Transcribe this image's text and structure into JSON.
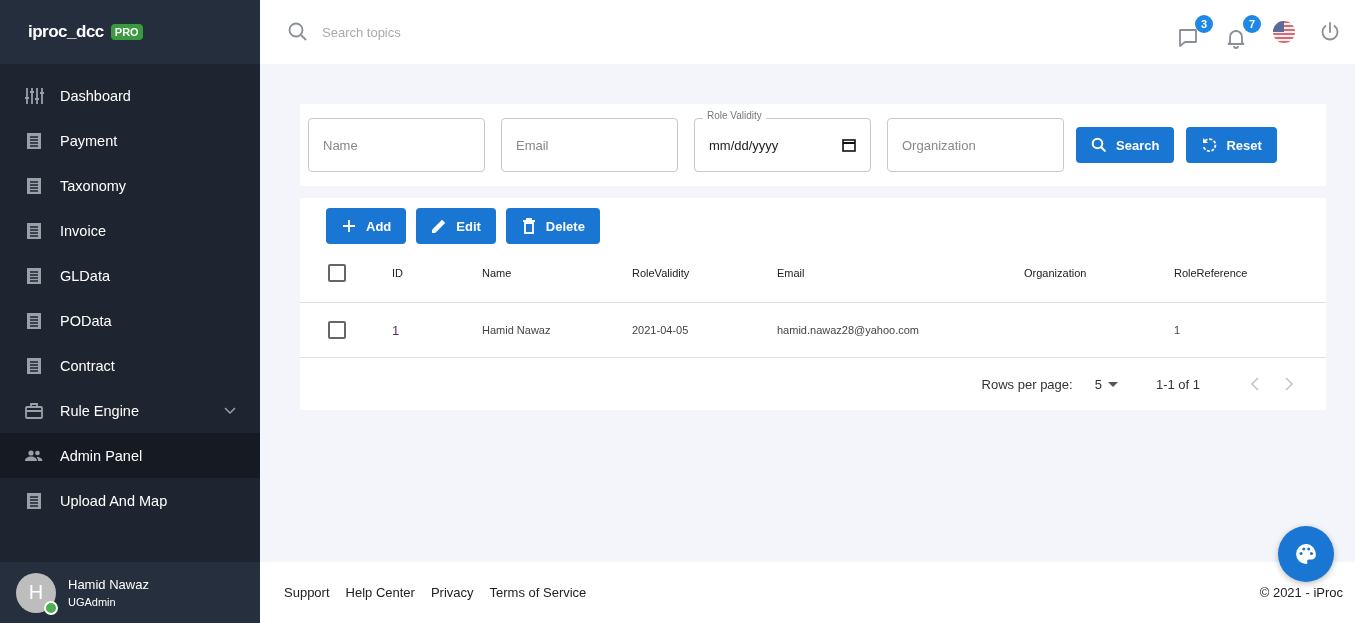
{
  "brand": {
    "name": "iproc_dcc",
    "badge": "PRO"
  },
  "sidebar": {
    "items": [
      {
        "label": "Dashboard",
        "kind": "link",
        "selected": false
      },
      {
        "label": "Payment",
        "kind": "link",
        "selected": false
      },
      {
        "label": "Taxonomy",
        "kind": "link",
        "selected": false
      },
      {
        "label": "Invoice",
        "kind": "link",
        "selected": false
      },
      {
        "label": "GLData",
        "kind": "link",
        "selected": false
      },
      {
        "label": "POData",
        "kind": "link",
        "selected": false
      },
      {
        "label": "Contract",
        "kind": "link",
        "selected": false
      },
      {
        "label": "Rule Engine",
        "kind": "group",
        "expanded": false,
        "selected": false
      },
      {
        "label": "Admin Panel",
        "kind": "link",
        "selected": true
      },
      {
        "label": "Upload And Map",
        "kind": "link",
        "selected": false
      }
    ],
    "user": {
      "initial": "H",
      "name": "Hamid Nawaz",
      "role": "UGAdmin",
      "online": true
    }
  },
  "header": {
    "search": {
      "placeholder": "Search topics"
    },
    "messages_count": "3",
    "notifications_count": "7"
  },
  "filters": {
    "name": {
      "placeholder": "Name"
    },
    "email": {
      "placeholder": "Email"
    },
    "role_validity": {
      "label": "Role Validity",
      "placeholder": "mm/dd/yyyy"
    },
    "organization": {
      "placeholder": "Organization"
    },
    "buttons": [
      "Search",
      "Reset"
    ]
  },
  "toolbar": [
    "Add",
    "Edit",
    "Delete"
  ],
  "table": {
    "header_checked": false,
    "columns": [
      "ID",
      "Name",
      "RoleValidity",
      "Email",
      "Organization",
      "RoleReference"
    ],
    "rows": [
      {
        "checked": false,
        "cells": [
          "1",
          "Hamid Nawaz",
          "2021-04-05",
          "hamid.nawaz28@yahoo.com",
          "",
          "1"
        ]
      }
    ]
  },
  "pagination": {
    "label": "Rows per page:",
    "rows_per_page": "5",
    "range": "1-1 of 1"
  },
  "footer": {
    "links": [
      "Support",
      "Help Center",
      "Privacy",
      "Terms of Service"
    ],
    "copyright": "© 2021 - iProc"
  }
}
